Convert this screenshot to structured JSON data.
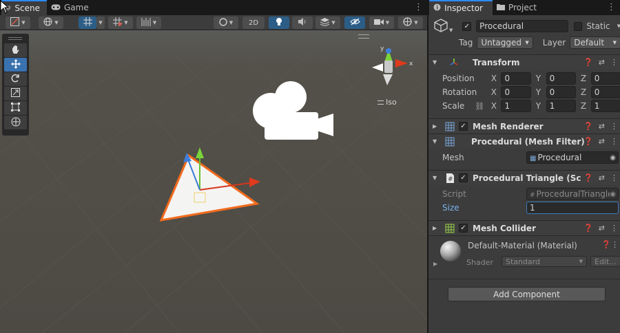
{
  "scene_tabs": [
    {
      "label": "Scene",
      "icon": "scene-icon",
      "active": true
    },
    {
      "label": "Game",
      "icon": "gamepad-icon",
      "active": false
    }
  ],
  "inspector_tabs": [
    {
      "label": "Inspector",
      "icon": "info-icon",
      "active": true
    },
    {
      "label": "Project",
      "icon": "folder-icon",
      "active": false
    }
  ],
  "scene_toolbar": {
    "mode_2d": "2D",
    "iso_label": "Iso"
  },
  "inspector": {
    "object_name": "Procedural",
    "static_label": "Static",
    "tag_label": "Tag",
    "tag_value": "Untagged",
    "layer_label": "Layer",
    "layer_value": "Default",
    "transform": {
      "title": "Transform",
      "position_label": "Position",
      "rotation_label": "Rotation",
      "scale_label": "Scale",
      "position": {
        "x": "0",
        "y": "0",
        "z": "0"
      },
      "rotation": {
        "x": "0",
        "y": "0",
        "z": "0"
      },
      "scale": {
        "x": "1",
        "y": "1",
        "z": "1"
      }
    },
    "mesh_renderer_title": "Mesh Renderer",
    "mesh_filter": {
      "title": "Procedural (Mesh Filter)",
      "mesh_label": "Mesh",
      "mesh_value": "Procedural"
    },
    "script_component": {
      "title": "Procedural Triangle (Script)",
      "script_label": "Script",
      "script_value": "ProceduralTriangle",
      "size_label": "Size",
      "size_value": "1"
    },
    "mesh_collider_title": "Mesh Collider",
    "material": {
      "name": "Default-Material (Material)",
      "shader_label": "Shader",
      "shader_value": "Standard",
      "edit_label": "Edit..."
    },
    "add_component": "Add Component"
  },
  "colors": {
    "accent": "#2c8bff",
    "selection_outline": "#f26b1d",
    "scene_bg": "#4e4c45",
    "inspector_bg": "#3c3c3c"
  }
}
